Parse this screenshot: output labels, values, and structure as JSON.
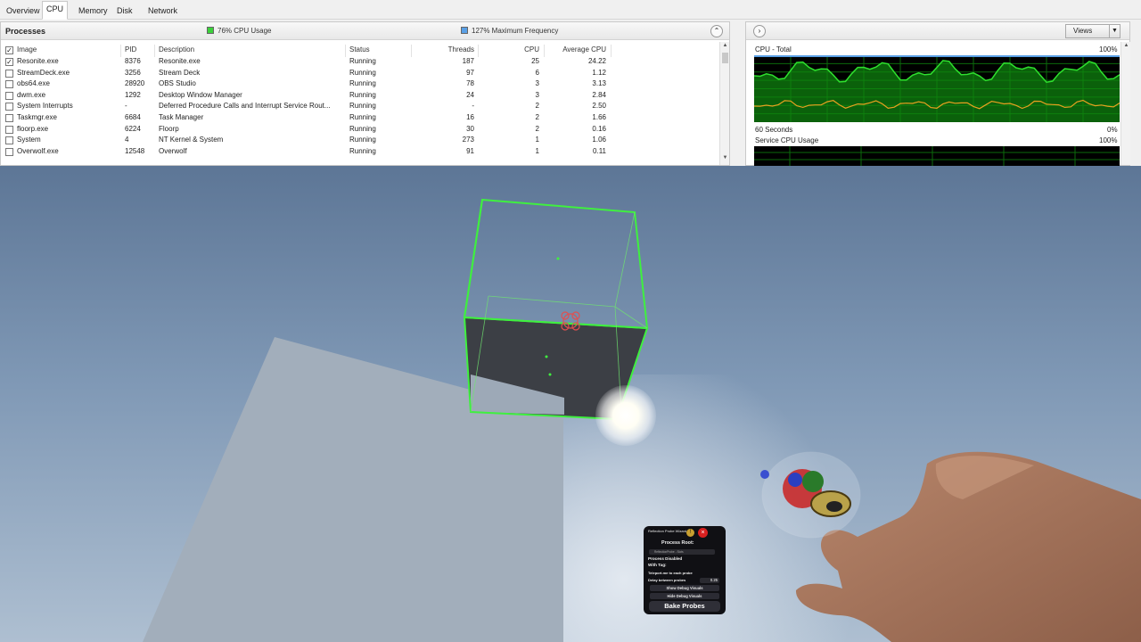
{
  "resmon": {
    "tabs": [
      "Overview",
      "CPU",
      "Memory",
      "Disk",
      "Network"
    ],
    "active_tab": "CPU",
    "processes": {
      "title": "Processes",
      "cpu_usage_label": "76% CPU Usage",
      "max_freq_label": "127% Maximum Frequency",
      "colors": {
        "cpu_usage": "#3bd13b",
        "max_freq": "#5aa0e6"
      },
      "columns": [
        "Image",
        "PID",
        "Description",
        "Status",
        "Threads",
        "CPU",
        "Average CPU"
      ],
      "rows": [
        {
          "checked": true,
          "image": "Resonite.exe",
          "pid": "8376",
          "description": "Resonite.exe",
          "status": "Running",
          "threads": "187",
          "cpu": "25",
          "avg_cpu": "24.22"
        },
        {
          "checked": false,
          "image": "StreamDeck.exe",
          "pid": "3256",
          "description": "Stream Deck",
          "status": "Running",
          "threads": "97",
          "cpu": "6",
          "avg_cpu": "1.12"
        },
        {
          "checked": false,
          "image": "obs64.exe",
          "pid": "28920",
          "description": "OBS Studio",
          "status": "Running",
          "threads": "78",
          "cpu": "3",
          "avg_cpu": "3.13"
        },
        {
          "checked": false,
          "image": "dwm.exe",
          "pid": "1292",
          "description": "Desktop Window Manager",
          "status": "Running",
          "threads": "24",
          "cpu": "3",
          "avg_cpu": "2.84"
        },
        {
          "checked": false,
          "image": "System Interrupts",
          "pid": "-",
          "description": "Deferred Procedure Calls and Interrupt Service Rout...",
          "status": "Running",
          "threads": "-",
          "cpu": "2",
          "avg_cpu": "2.50"
        },
        {
          "checked": false,
          "image": "Taskmgr.exe",
          "pid": "6684",
          "description": "Task Manager",
          "status": "Running",
          "threads": "16",
          "cpu": "2",
          "avg_cpu": "1.66"
        },
        {
          "checked": false,
          "image": "floorp.exe",
          "pid": "6224",
          "description": "Floorp",
          "status": "Running",
          "threads": "30",
          "cpu": "2",
          "avg_cpu": "0.16"
        },
        {
          "checked": false,
          "image": "System",
          "pid": "4",
          "description": "NT Kernel & System",
          "status": "Running",
          "threads": "273",
          "cpu": "1",
          "avg_cpu": "1.06"
        },
        {
          "checked": false,
          "image": "Overwolf.exe",
          "pid": "12548",
          "description": "Overwolf",
          "status": "Running",
          "threads": "91",
          "cpu": "1",
          "avg_cpu": "0.11"
        }
      ]
    },
    "graphs": {
      "views_label": "Views",
      "cpu_total": {
        "label": "CPU - Total",
        "max": "100%",
        "min": "0%",
        "time": "60 Seconds"
      },
      "service_cpu": {
        "label": "Service CPU Usage",
        "max": "100%"
      },
      "colors": {
        "usage_line": "#2ee02e",
        "usage_fill": "#0f8a0f",
        "freq_line": "#e8a020",
        "grid": "#0c6a0c"
      }
    }
  },
  "probe_panel": {
    "title": "Reflection Probe Wizard",
    "process_root_label": "Process Root:",
    "root_field": "ReflectionProbe - Slots",
    "process_disabled": "Process Disabled",
    "with_tag": "With Tag:",
    "teleport_label": "Teleport.me to each probe",
    "delay_label": "Delay between probes",
    "delay_value": "0.25",
    "show_debug": "Show Debug Visuals",
    "hide_debug": "Hide Debug Visuals",
    "bake_button": "Bake Probes",
    "close_icon": "×",
    "info_icon": "!"
  }
}
